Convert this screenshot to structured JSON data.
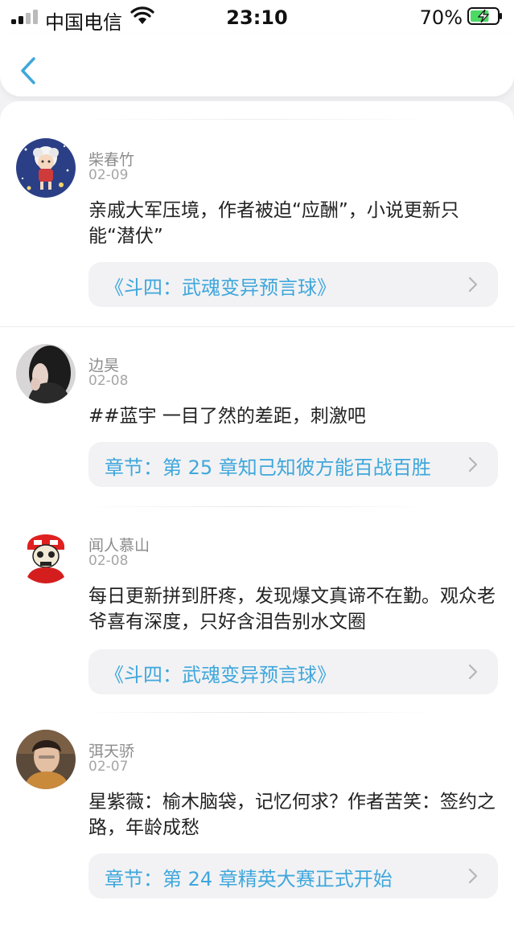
{
  "status_bar": {
    "carrier": "中国电信",
    "time": "23:10",
    "battery_percent": "70%",
    "battery_level": 0.7,
    "battery_color": "#4cd964"
  },
  "nav": {
    "back_icon": "chevron-left-icon",
    "accent_color": "#3fa7dc"
  },
  "posts": [
    {
      "username": "柴春竹",
      "date": "02-09",
      "content": "亲戚大军压境，作者被迫“应酬”，小说更新只能“潜伏”",
      "link": "《斗四：武魂变异预言球》"
    },
    {
      "username": "边昊",
      "date": "02-08",
      "content": "##蓝宇 一目了然的差距，刺激吧",
      "link": "章节：第 25 章知己知彼方能百战百胜"
    },
    {
      "username": "闻人慕山",
      "date": "02-08",
      "content": "每日更新拼到肝疼，发现爆文真谛不在勤。观众老爷喜有深度，只好含泪告别水文圈",
      "link": "《斗四：武魂变异预言球》"
    },
    {
      "username": "弭天骄",
      "date": "02-07",
      "content": "星紫薇：榆木脑袋，记忆何求？作者苦笑：签约之路，年龄成愁",
      "link": "章节：第 24 章精英大赛正式开始"
    }
  ]
}
